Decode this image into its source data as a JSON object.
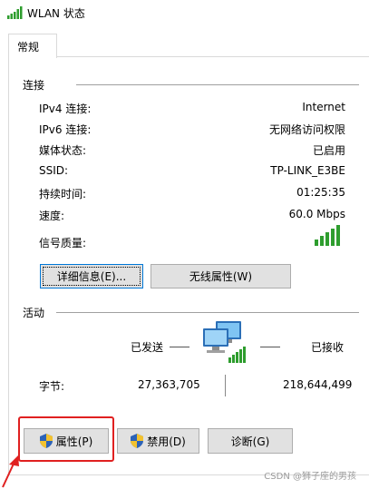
{
  "window": {
    "title": "WLAN 状态"
  },
  "tabs": [
    {
      "label": "常规"
    }
  ],
  "connection": {
    "group_label": "连接",
    "rows": [
      {
        "label": "IPv4 连接:",
        "value": "Internet"
      },
      {
        "label": "IPv6 连接:",
        "value": "无网络访问权限"
      },
      {
        "label": "媒体状态:",
        "value": "已启用"
      },
      {
        "label": "SSID:",
        "value": "TP-LINK_E3BE"
      },
      {
        "label": "持续时间:",
        "value": "01:25:35"
      },
      {
        "label": "速度:",
        "value": "60.0 Mbps"
      }
    ],
    "signal_label": "信号质量:",
    "signal_bars": 5
  },
  "buttons_top": {
    "details": "详细信息(E)...",
    "wireless": "无线属性(W)"
  },
  "activity": {
    "group_label": "活动",
    "sent_label": "已发送",
    "received_label": "已接收",
    "bytes_label": "字节:",
    "bytes_sent": "27,363,705",
    "bytes_received": "218,644,499"
  },
  "buttons_bottom": {
    "properties": "属性(P)",
    "disable": "禁用(D)",
    "diagnose": "诊断(G)"
  },
  "watermark": "CSDN @狮子座的男孩",
  "colors": {
    "accent": "#0078d7",
    "highlight": "#e02020",
    "signal": "#2e9d2e"
  }
}
